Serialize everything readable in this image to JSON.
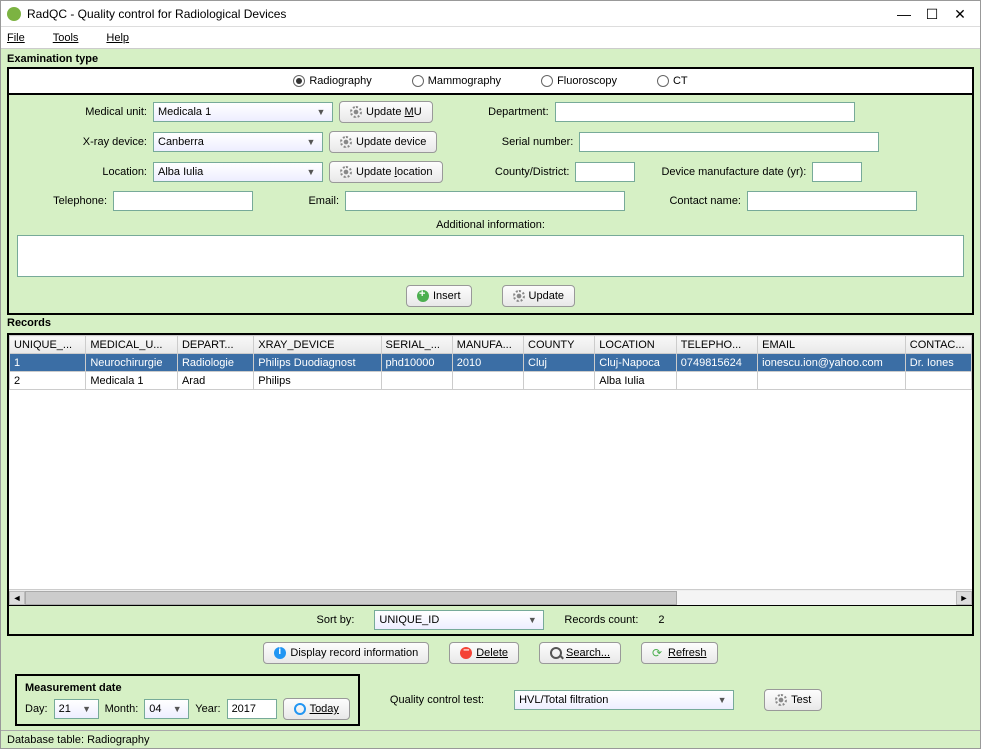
{
  "window": {
    "title": "RadQC - Quality control for Radiological Devices"
  },
  "menu": {
    "file": "File",
    "tools": "Tools",
    "help": "Help"
  },
  "exam": {
    "legend": "Examination type",
    "options": [
      "Radiography",
      "Mammography",
      "Fluoroscopy",
      "CT"
    ],
    "selected": "Radiography"
  },
  "form": {
    "medical_unit_label": "Medical unit:",
    "medical_unit_value": "Medicala 1",
    "update_mu": "Update MU",
    "xray_label": "X-ray device:",
    "xray_value": "Canberra",
    "update_device": "Update device",
    "location_label": "Location:",
    "location_value": "Alba Iulia",
    "update_location": "Update location",
    "department_label": "Department:",
    "department_value": "",
    "serial_label": "Serial number:",
    "serial_value": "",
    "county_label": "County/District:",
    "county_value": "",
    "mfg_label": "Device manufacture date (yr):",
    "mfg_value": "",
    "tel_label": "Telephone:",
    "tel_value": "",
    "email_label": "Email:",
    "email_value": "",
    "contact_label": "Contact name:",
    "contact_value": "",
    "addinfo_label": "Additional information:",
    "insert": "Insert",
    "update": "Update"
  },
  "records": {
    "legend": "Records",
    "columns": [
      "UNIQUE_...",
      "MEDICAL_U...",
      "DEPART...",
      "XRAY_DEVICE",
      "SERIAL_...",
      "MANUFA...",
      "COUNTY",
      "LOCATION",
      "TELEPHO...",
      "EMAIL",
      "CONTAC..."
    ],
    "rows": [
      {
        "sel": true,
        "cells": [
          "1",
          "Neurochirurgie",
          "Radiologie",
          "Philips Duodiagnost",
          "phd10000",
          "2010",
          "Cluj",
          "Cluj-Napoca",
          "0749815624",
          "ionescu.ion@yahoo.com",
          "Dr. Iones"
        ]
      },
      {
        "sel": false,
        "cells": [
          "2",
          "Medicala 1",
          "Arad",
          "Philips",
          "",
          "",
          "",
          "Alba Iulia",
          "",
          "",
          ""
        ]
      }
    ],
    "sort_label": "Sort by:",
    "sort_value": "UNIQUE_ID",
    "count_label": "Records count:",
    "count_value": "2"
  },
  "actions": {
    "display": "Display record information",
    "delete": "Delete",
    "search": "Search...",
    "refresh": "Refresh"
  },
  "measure": {
    "legend": "Measurement date",
    "day_label": "Day:",
    "day_value": "21",
    "month_label": "Month:",
    "month_value": "04",
    "year_label": "Year:",
    "year_value": "2017",
    "today": "Today"
  },
  "qc": {
    "label": "Quality control test:",
    "value": "HVL/Total filtration",
    "test": "Test"
  },
  "status": "Database table: Radiography"
}
